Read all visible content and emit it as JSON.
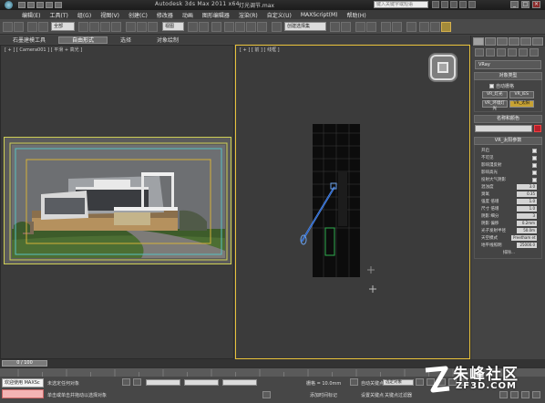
{
  "title": {
    "app": "Autodesk 3ds Max  2011 x64",
    "file": "灯光调节.max",
    "search_placeholder": "键入关键字或短语"
  },
  "menu": [
    "编辑(E)",
    "工具(T)",
    "组(G)",
    "视图(V)",
    "创建(C)",
    "修改器",
    "动画",
    "图形编辑器",
    "渲染(R)",
    "自定义(U)",
    "MAXScript(M)",
    "帮助(H)"
  ],
  "toolbar": {
    "selection_filter": "全部",
    "view_dropdown": "视图",
    "named_set": "创建选择集"
  },
  "ribbon": [
    "石墨建模工具",
    "自由形式",
    "选择",
    "对象绘制"
  ],
  "viewports": {
    "left_label": "[ + ] [ Camera001 ] [ 平滑 + 高光 ]",
    "right_label": "[ + ] [ 前 ] [ 线框 ]"
  },
  "command_panel": {
    "category": "VRay",
    "object_type_header": "对象类型",
    "autogrid": "自动栅格",
    "object_buttons": [
      "VR_灯光",
      "VR_IES",
      "VR_环境灯光",
      "VR_太阳"
    ],
    "name_color_header": "名称和颜色",
    "params_header": "VR_太阳参数",
    "params": [
      {
        "label": "开启",
        "kind": "check"
      },
      {
        "label": "不可见",
        "kind": "check"
      },
      {
        "label": "影响漫反射",
        "kind": "check"
      },
      {
        "label": "影响高光",
        "kind": "check"
      },
      {
        "label": "投射大气阴影",
        "kind": "check"
      },
      {
        "label": "混浊度",
        "kind": "val",
        "value": "3.0"
      },
      {
        "label": "臭氧",
        "kind": "val",
        "value": "0.35"
      },
      {
        "label": "强度 倍增",
        "kind": "val",
        "value": "1.0"
      },
      {
        "label": "尺寸 倍增",
        "kind": "val",
        "value": "1.0"
      },
      {
        "label": "阴影 细分",
        "kind": "val",
        "value": "3"
      },
      {
        "label": "阴影 偏移",
        "kind": "val",
        "value": "0.2mm"
      },
      {
        "label": "光子发射半径",
        "kind": "val",
        "value": "50.0m"
      },
      {
        "label": "天空模式",
        "kind": "sel",
        "value": "Preetham et"
      },
      {
        "label": "地平线照明",
        "kind": "val",
        "value": "25000.0"
      },
      {
        "label": "排除...",
        "kind": "btn"
      }
    ]
  },
  "trackbar": {
    "frame": "0 / 100"
  },
  "status": {
    "welcome": "欢迎使用 MAXSc",
    "line1": "未选定任何对象",
    "line2": "单击或单击并拖动以选择对象",
    "grid": "栅格 = 10.0mm",
    "autokey": "自动关键点",
    "selected": "选定对象",
    "setkey": "设置关键点",
    "keyfilter": "关键点过滤器",
    "addtime": "添加时间标记",
    "x": "",
    "y": "",
    "z": ""
  },
  "watermark": {
    "brand": "朱峰社区",
    "url": "ZF3D.COM"
  },
  "colors": {
    "active_border": "#e9c23a",
    "light_color": "#b71e2a",
    "selected_button": "#c7a233"
  }
}
